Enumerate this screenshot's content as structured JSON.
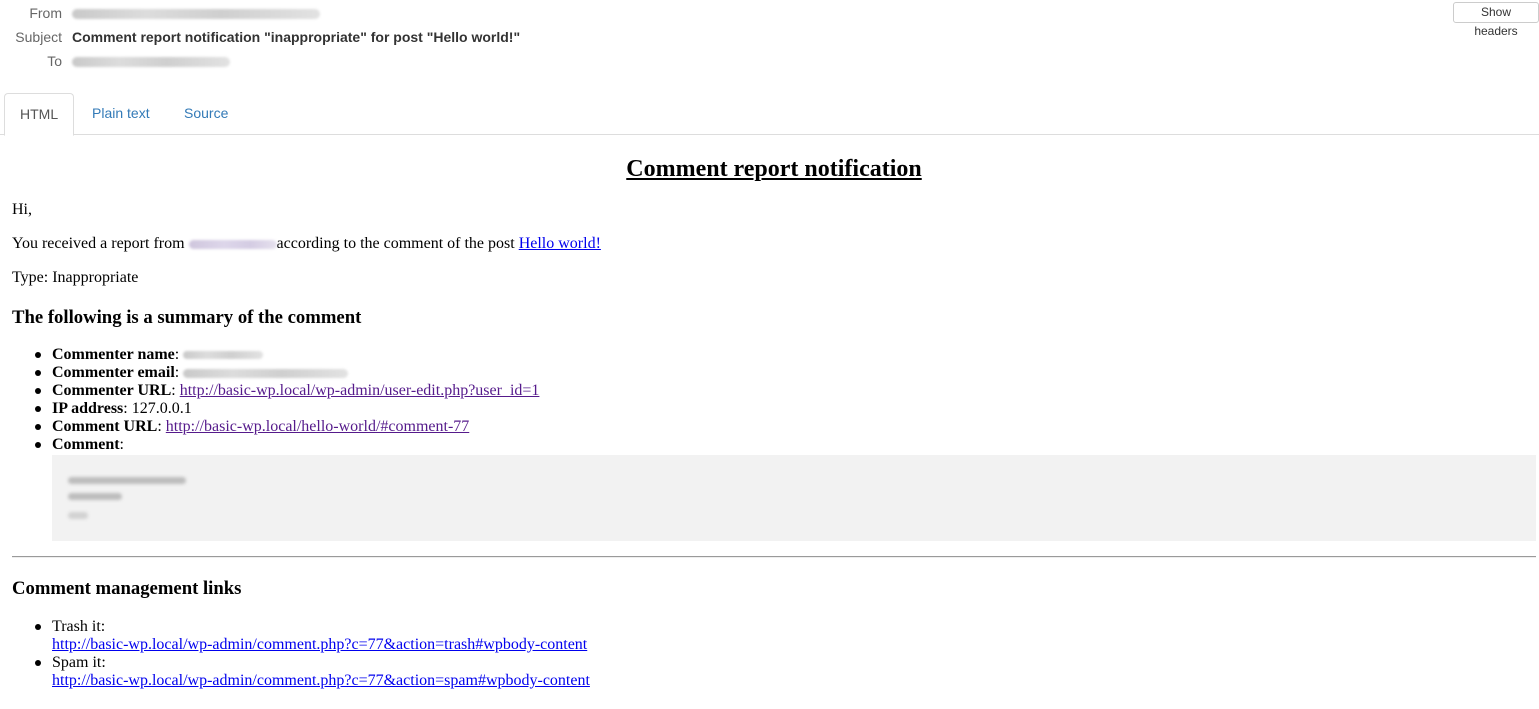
{
  "header": {
    "from_label": "From",
    "subject_label": "Subject",
    "to_label": "To",
    "subject": "Comment report notification \"inappropriate\" for post \"Hello world!\"",
    "show_headers_label": "Show headers"
  },
  "tabs": [
    {
      "label": "HTML",
      "active": true
    },
    {
      "label": "Plain text",
      "active": false
    },
    {
      "label": "Source",
      "active": false
    }
  ],
  "mail": {
    "title": "Comment report notification",
    "greeting": "Hi,",
    "report_prefix": "You received a report from",
    "report_suffix": "according to the comment of the post",
    "post_link": "Hello world!",
    "type_text": "Type: Inappropriate",
    "summary_heading": "The following is a summary of the comment",
    "summary": {
      "commenter_name_label": "Commenter name",
      "commenter_email_label": "Commenter email",
      "commenter_url_label": "Commenter URL",
      "commenter_url": "http://basic-wp.local/wp-admin/user-edit.php?user_id=1",
      "ip_label": "IP address",
      "ip_value": "127.0.0.1",
      "comment_url_label": "Comment URL",
      "comment_url": "http://basic-wp.local/hello-world/#comment-77",
      "comment_label": "Comment"
    },
    "management_heading": "Comment management links",
    "management": {
      "trash_label": "Trash it:",
      "trash_url": "http://basic-wp.local/wp-admin/comment.php?c=77&action=trash#wpbody-content",
      "spam_label": "Spam it:",
      "spam_url": "http://basic-wp.local/wp-admin/comment.php?c=77&action=spam#wpbody-content"
    }
  }
}
